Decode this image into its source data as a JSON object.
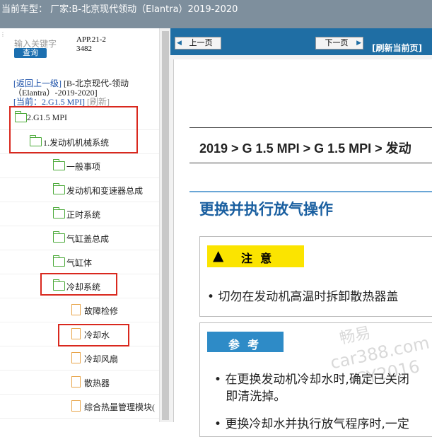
{
  "window": {
    "title": "当前车型：  厂家:B-北京现代领动（Elantra）2019-2020"
  },
  "left_panel": {
    "search_placeholder": "输入关键字",
    "app_code": "APP.21-23482",
    "query_button": "查询",
    "back_link": "[返回上一级]",
    "back_label": "[B-北京现代-领动（Elantra）-2019-2020]",
    "current_prefix": "[当前：",
    "current_value": "2.G1.5 MPI]",
    "refresh": "[刷新]",
    "tree": [
      {
        "label": "2.G1.5 MPI",
        "type": "folder",
        "level": 0
      },
      {
        "label": "1.发动机机械系统",
        "type": "folder",
        "level": 1
      },
      {
        "label": "一般事项",
        "type": "folder",
        "level": 2
      },
      {
        "label": "发动机和变速器总成",
        "type": "folder",
        "level": 2
      },
      {
        "label": "正时系统",
        "type": "folder",
        "level": 2
      },
      {
        "label": "气缸盖总成",
        "type": "folder",
        "level": 2
      },
      {
        "label": "气缸体",
        "type": "folder",
        "level": 2
      },
      {
        "label": "冷却系统",
        "type": "folder",
        "level": 2
      },
      {
        "label": "故障检修",
        "type": "file",
        "level": 3
      },
      {
        "label": "冷却水",
        "type": "file",
        "level": 3
      },
      {
        "label": "冷却风扇",
        "type": "file",
        "level": 3
      },
      {
        "label": "散热器",
        "type": "file",
        "level": 3
      },
      {
        "label": "综合热量管理模块(",
        "type": "file",
        "level": 3
      }
    ]
  },
  "toolbar": {
    "prev_page": "上一页",
    "next_page": "下一页",
    "refresh_page": "[刷新当前页]"
  },
  "document": {
    "breadcrumb": "2019 > G 1.5 MPI > G 1.5 MPI > 发动",
    "section_title": "更换并执行放气操作",
    "caution_label": "注  意",
    "caution_text": "切勿在发动机高温时拆卸散热器盖",
    "reference_label": "参  考",
    "reference_line1": "在更换发动机冷却水时,确定已关闭",
    "reference_line1b": "即清洗掉。",
    "reference_line2": "更换冷却水并执行放气程序时,一定",
    "watermark1": "畅易",
    "watermark2": "car388.com",
    "watermark3": "CY2016"
  },
  "colors": {
    "topbar": "#7e8f9d",
    "navbar": "#1f6ea4",
    "highlight_red": "#d9281e",
    "caution_yellow": "#fbe400",
    "reference_blue": "#2e8bc7",
    "title_blue": "#1a5fa0"
  }
}
